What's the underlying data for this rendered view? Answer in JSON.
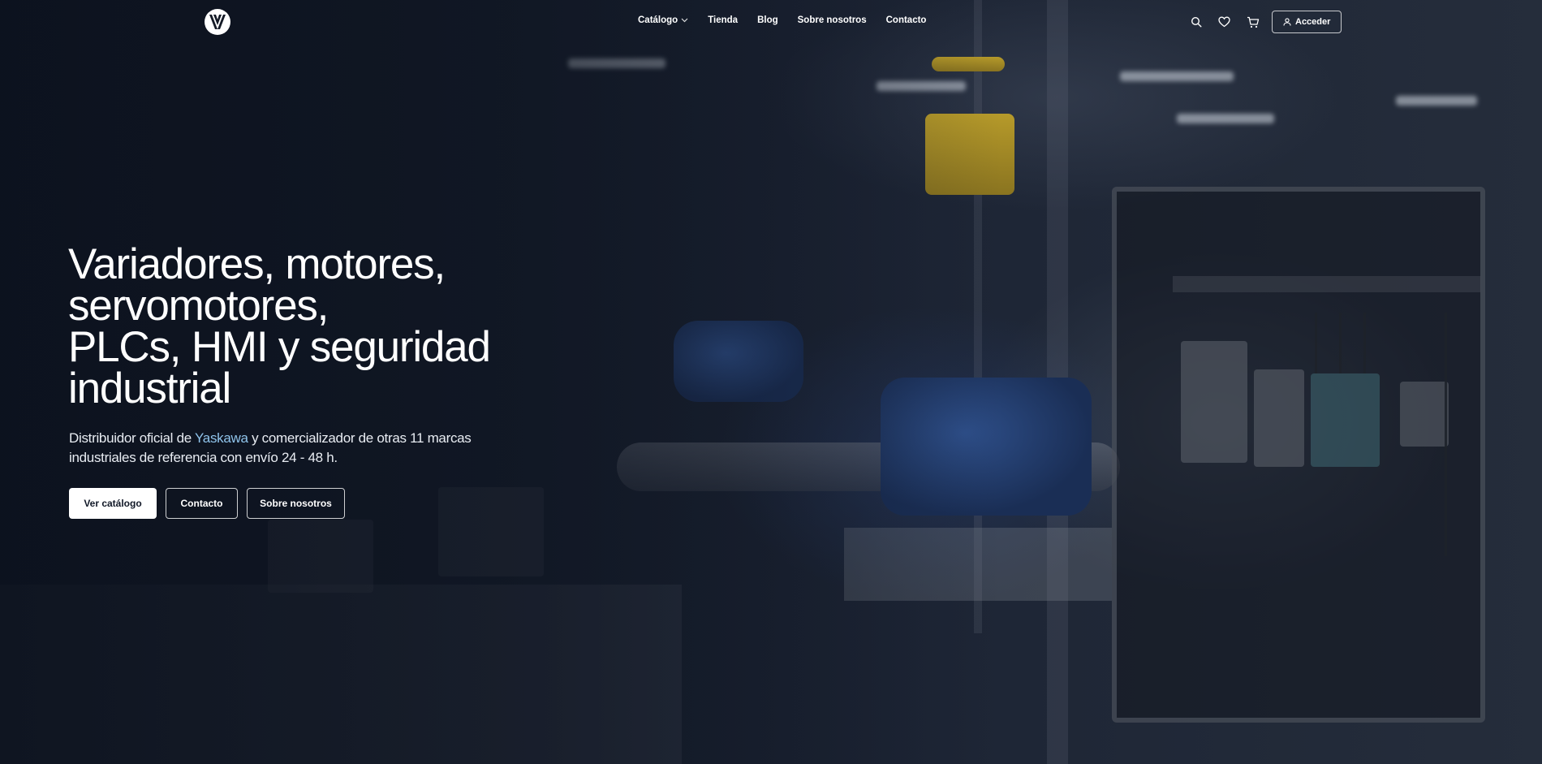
{
  "header": {
    "logo_icon": "v-logo-icon",
    "nav": [
      {
        "label": "Catálogo",
        "has_dropdown": true
      },
      {
        "label": "Tienda"
      },
      {
        "label": "Blog"
      },
      {
        "label": "Sobre nosotros"
      },
      {
        "label": "Contacto"
      }
    ],
    "tools": {
      "search_icon": "search-icon",
      "wishlist_icon": "heart-icon",
      "cart_icon": "cart-icon",
      "login_label": "Acceder",
      "login_icon": "user-icon"
    }
  },
  "hero": {
    "title_lines": [
      "Variadores, motores,",
      "servomotores,",
      "PLCs, HMI y seguridad",
      "industrial"
    ],
    "subtitle_before": "Distribuidor oficial de ",
    "subtitle_brand": "Yaskawa",
    "subtitle_after": " y comercializador de otras 11 marcas industriales de referencia con envío 24 - 48 h.",
    "buttons": {
      "catalog": "Ver catálogo",
      "contact": "Contacto",
      "about": "Sobre nosotros"
    }
  },
  "colors": {
    "background": "#141a26",
    "brand_link": "#8fc3ea",
    "text": "#ffffff"
  }
}
